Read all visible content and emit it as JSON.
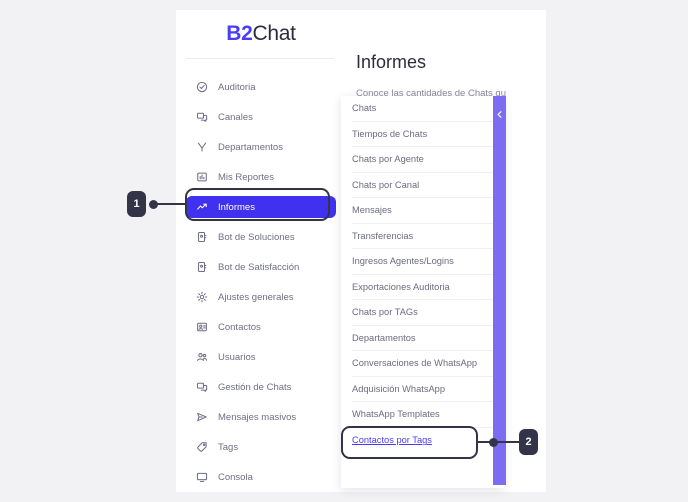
{
  "brand": {
    "part1": "B2",
    "part2": "Chat"
  },
  "sidebar": {
    "items": [
      {
        "label": "Auditoria",
        "icon": "check-circle-icon",
        "active": false
      },
      {
        "label": "Canales",
        "icon": "channels-icon",
        "active": false
      },
      {
        "label": "Departamentos",
        "icon": "branch-icon",
        "active": false
      },
      {
        "label": "Mis Reportes",
        "icon": "bar-chart-icon",
        "active": false
      },
      {
        "label": "Informes",
        "icon": "trending-up-icon",
        "active": true
      },
      {
        "label": "Bot de Soluciones",
        "icon": "bot-icon",
        "active": false
      },
      {
        "label": "Bot de Satisfacción",
        "icon": "bot-icon",
        "active": false
      },
      {
        "label": "Ajustes generales",
        "icon": "gear-icon",
        "active": false
      },
      {
        "label": "Contactos",
        "icon": "contact-card-icon",
        "active": false
      },
      {
        "label": "Usuarios",
        "icon": "users-icon",
        "active": false
      },
      {
        "label": "Gestión de Chats",
        "icon": "chats-icon",
        "active": false
      },
      {
        "label": "Mensajes masivos",
        "icon": "send-icon",
        "active": false
      },
      {
        "label": "Tags",
        "icon": "tag-icon",
        "active": false
      },
      {
        "label": "Consola",
        "icon": "monitor-icon",
        "active": false
      }
    ]
  },
  "main": {
    "title": "Informes",
    "subtitle": "Conoce las cantidades de Chats qu"
  },
  "dropdown": {
    "collapse_icon": "chevron-left-icon",
    "items": [
      {
        "label": "Chats",
        "highlight": false
      },
      {
        "label": "Tiempos de Chats",
        "highlight": false
      },
      {
        "label": "Chats por Agente",
        "highlight": false
      },
      {
        "label": "Chats por Canal",
        "highlight": false
      },
      {
        "label": "Mensajes",
        "highlight": false
      },
      {
        "label": "Transferencias",
        "highlight": false
      },
      {
        "label": "Ingresos Agentes/Logins",
        "highlight": false
      },
      {
        "label": "Exportaciones Auditoria",
        "highlight": false
      },
      {
        "label": "Chats por TAGs",
        "highlight": false
      },
      {
        "label": "Departamentos",
        "highlight": false
      },
      {
        "label": "Conversaciones de WhatsApp",
        "highlight": false
      },
      {
        "label": "Adquisición WhatsApp",
        "highlight": false
      },
      {
        "label": "WhatsApp Templates",
        "highlight": false
      },
      {
        "label": "Contactos por Tags",
        "highlight": true
      }
    ]
  },
  "annotations": [
    {
      "number": "1",
      "target": "sidebar-item-informes"
    },
    {
      "number": "2",
      "target": "dropdown-item-contactos-por-tags"
    }
  ],
  "colors": {
    "accent_purple": "#4b3df5",
    "active_item": "#4031f0",
    "scrollbar_purple": "#7b6cf2",
    "annotation_dark": "#343449",
    "page_background": "#f2f2f5",
    "text_muted": "#6b6b80"
  }
}
